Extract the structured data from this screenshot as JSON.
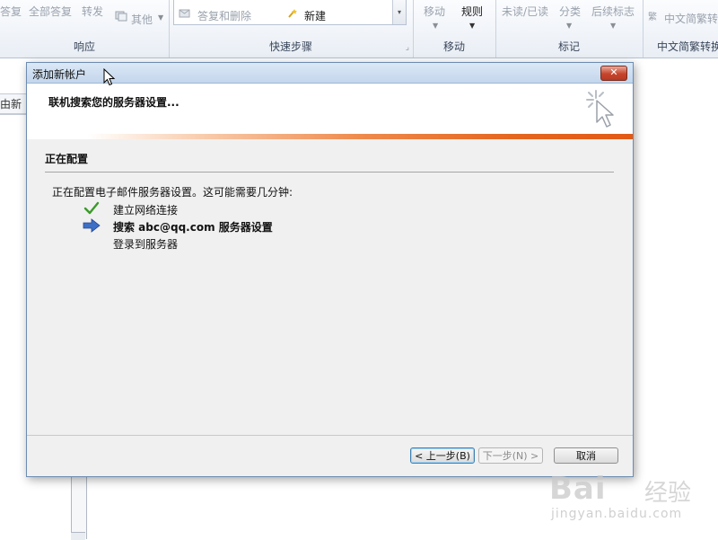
{
  "ribbon": {
    "respond": {
      "reply_label": "答复",
      "reply_all_label": "全部答复",
      "forward_label": "转发",
      "more_label": "其他",
      "group_label": "响应"
    },
    "quick_steps": {
      "item_reply_delete": "答复和删除",
      "item_new": "新建",
      "group_label": "快速步骤"
    },
    "move": {
      "move_label": "移动",
      "rules_label": "规则",
      "group_label": "移动"
    },
    "tags": {
      "read_unread_label": "未读/已读",
      "categorize_label": "分类",
      "follow_up_label": "后续标志",
      "group_label": "标记"
    },
    "chinese": {
      "item_label": "中文简繁转换",
      "group_label": "中文简繁转换"
    }
  },
  "background": {
    "left_tab_label": "由新"
  },
  "dialog": {
    "title": "添加新帐户",
    "close_label": "✕",
    "header_title": "联机搜索您的服务器设置...",
    "section_title": "正在配置",
    "description": "正在配置电子邮件服务器设置。这可能需要几分钟:",
    "steps": [
      {
        "label": "建立网络连接",
        "status": "done"
      },
      {
        "label": "搜索 abc@qq.com 服务器设置",
        "status": "current"
      },
      {
        "label": "登录到服务器",
        "status": "pending"
      }
    ],
    "buttons": {
      "back": "< 上一步(B)",
      "next": "下一步(N) >",
      "cancel": "取消"
    }
  },
  "watermark": {
    "logo": "Bai",
    "logo_cn": "经验",
    "url": "jingyan.baidu.com"
  },
  "colors": {
    "accent_orange": "#e5661f",
    "check_green": "#3a9a2a",
    "arrow_blue": "#3d6fc7",
    "close_red": "#c6452c"
  }
}
